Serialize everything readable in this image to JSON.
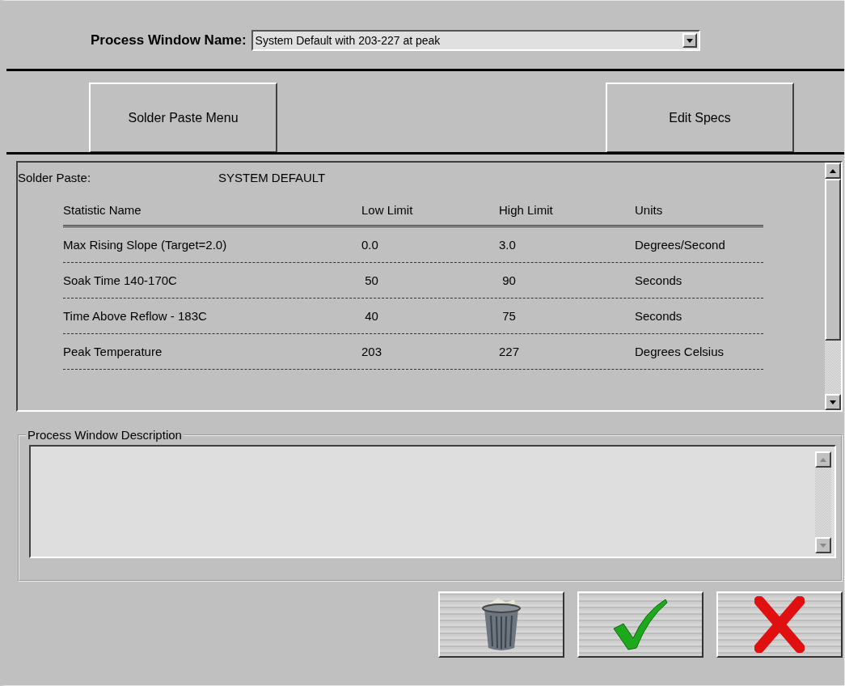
{
  "process_window": {
    "label": "Process Window Name:",
    "value": "System Default with 203-227 at peak"
  },
  "buttons": [
    {
      "label": "Solder Paste Menu"
    },
    {
      "label": "Edit Specs"
    }
  ],
  "spec_list": {
    "paste_label": "Solder Paste:",
    "paste_value": "SYSTEM DEFAULT",
    "columns": [
      "Statistic Name",
      "Low Limit",
      "High Limit",
      "Units"
    ],
    "rows": [
      {
        "name": "Max Rising Slope (Target=2.0)",
        "low": "0.0",
        "high": "3.0",
        "units": "Degrees/Second"
      },
      {
        "name": "Soak Time 140-170C",
        "low": " 50",
        "high": " 90",
        "units": "Seconds"
      },
      {
        "name": "Time Above Reflow - 183C",
        "low": " 40",
        "high": " 75",
        "units": "Seconds"
      },
      {
        "name": "Peak Temperature",
        "low": "203",
        "high": "227",
        "units": "Degrees Celsius"
      }
    ]
  },
  "description": {
    "label": "Process Window Description"
  },
  "actions": [
    {
      "kind": "delete"
    },
    {
      "kind": "ok"
    },
    {
      "kind": "cancel"
    }
  ]
}
